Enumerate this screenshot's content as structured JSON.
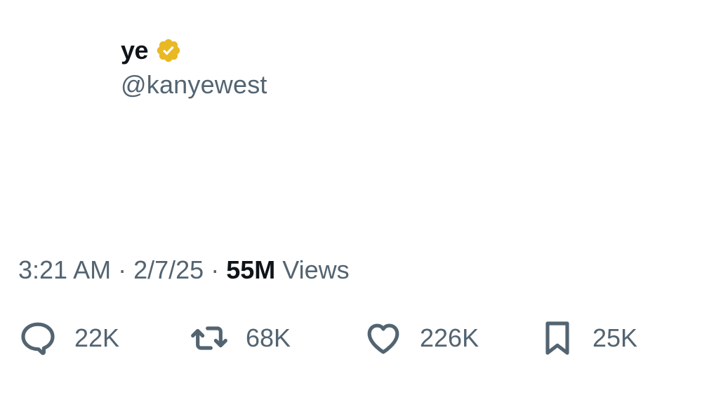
{
  "author": {
    "display_name": "ye",
    "handle": "@kanyewest",
    "verified_icon": "verified-badge-icon",
    "verified_color": "#e8b923"
  },
  "tweet": {
    "text": ""
  },
  "meta": {
    "time": "3:21 AM",
    "separator": "·",
    "date": "2/7/25",
    "views_count": "55M",
    "views_label": "Views"
  },
  "actions": {
    "reply": {
      "icon": "reply-icon",
      "count": "22K"
    },
    "repost": {
      "icon": "repost-icon",
      "count": "68K"
    },
    "like": {
      "icon": "heart-icon",
      "count": "226K"
    },
    "bookmark": {
      "icon": "bookmark-icon",
      "count": "25K"
    }
  },
  "colors": {
    "primary_text": "#0f1419",
    "secondary_text": "#536471",
    "background": "#ffffff"
  }
}
